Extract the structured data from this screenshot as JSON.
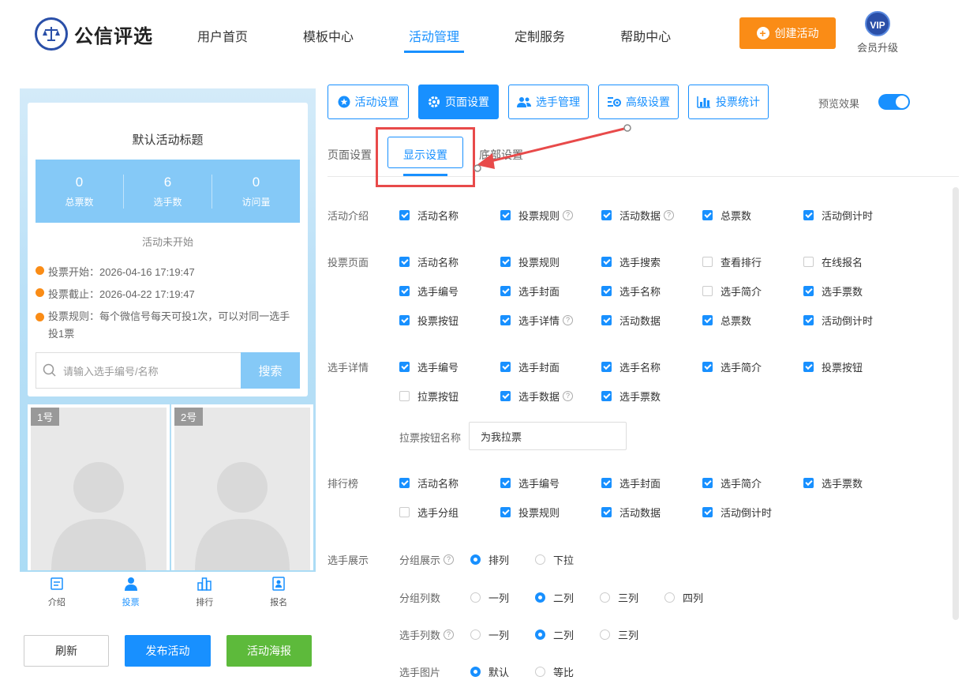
{
  "header": {
    "logo_text": "公信评选",
    "nav": [
      "用户首页",
      "模板中心",
      "活动管理",
      "定制服务",
      "帮助中心"
    ],
    "create_label": "创建活动",
    "vip_badge": "VIP",
    "vip_label": "会员升级"
  },
  "preview": {
    "title": "默认活动标题",
    "stats": [
      {
        "value": "0",
        "label": "总票数"
      },
      {
        "value": "6",
        "label": "选手数"
      },
      {
        "value": "0",
        "label": "访问量"
      }
    ],
    "status": "活动未开始",
    "vote_start": "投票开始：2026-04-16 17:19:47",
    "vote_end": "投票截止：2026-04-22 17:19:47",
    "vote_rule": "投票规则：每个微信号每天可投1次，可以对同一选手投1票",
    "search_placeholder": "请输入选手编号/名称",
    "search_btn": "搜索",
    "players": [
      "1号",
      "2号"
    ],
    "tabs": [
      "介绍",
      "投票",
      "排行",
      "报名"
    ]
  },
  "actions": {
    "refresh": "刷新",
    "publish": "发布活动",
    "poster": "活动海报"
  },
  "toolbar": {
    "buttons": [
      "活动设置",
      "页面设置",
      "选手管理",
      "高级设置",
      "投票统计"
    ],
    "preview_label": "预览效果"
  },
  "subtabs": [
    "页面设置",
    "显示设置",
    "底部设置"
  ],
  "sections": {
    "intro": {
      "label": "活动介绍",
      "options": [
        {
          "text": "活动名称",
          "checked": true
        },
        {
          "text": "投票规则",
          "checked": true,
          "help": "?"
        },
        {
          "text": "活动数据",
          "checked": true,
          "help": "?"
        },
        {
          "text": "总票数",
          "checked": true
        },
        {
          "text": "活动倒计时",
          "checked": true
        }
      ]
    },
    "vote": {
      "label": "投票页面",
      "options": [
        {
          "text": "活动名称",
          "checked": true
        },
        {
          "text": "投票规则",
          "checked": true
        },
        {
          "text": "选手搜索",
          "checked": true
        },
        {
          "text": "查看排行",
          "checked": false
        },
        {
          "text": "在线报名",
          "checked": false
        },
        {
          "text": "选手编号",
          "checked": true
        },
        {
          "text": "选手封面",
          "checked": true
        },
        {
          "text": "选手名称",
          "checked": true
        },
        {
          "text": "选手简介",
          "checked": false
        },
        {
          "text": "选手票数",
          "checked": true
        },
        {
          "text": "投票按钮",
          "checked": true
        },
        {
          "text": "选手详情",
          "checked": true,
          "help": "?"
        },
        {
          "text": "活动数据",
          "checked": true
        },
        {
          "text": "总票数",
          "checked": true
        },
        {
          "text": "活动倒计时",
          "checked": true
        }
      ]
    },
    "detail": {
      "label": "选手详情",
      "options": [
        {
          "text": "选手编号",
          "checked": true
        },
        {
          "text": "选手封面",
          "checked": true
        },
        {
          "text": "选手名称",
          "checked": true
        },
        {
          "text": "选手简介",
          "checked": true
        },
        {
          "text": "投票按钮",
          "checked": true
        },
        {
          "text": "拉票按钮",
          "checked": false
        },
        {
          "text": "选手数据",
          "checked": true,
          "help": "?"
        },
        {
          "text": "选手票数",
          "checked": true
        }
      ],
      "canvass_label": "拉票按钮名称",
      "canvass_value": "为我拉票"
    },
    "rank": {
      "label": "排行榜",
      "options": [
        {
          "text": "活动名称",
          "checked": true
        },
        {
          "text": "选手编号",
          "checked": true
        },
        {
          "text": "选手封面",
          "checked": true
        },
        {
          "text": "选手简介",
          "checked": true
        },
        {
          "text": "选手票数",
          "checked": true
        },
        {
          "text": "选手分组",
          "checked": false
        },
        {
          "text": "投票规则",
          "checked": true
        },
        {
          "text": "活动数据",
          "checked": true
        },
        {
          "text": "活动倒计时",
          "checked": true
        }
      ]
    },
    "display": {
      "label": "选手展示",
      "group_show": {
        "label": "分组展示",
        "help": "?",
        "options": [
          {
            "text": "排列",
            "checked": true
          },
          {
            "text": "下拉",
            "checked": false
          }
        ]
      },
      "group_cols": {
        "label": "分组列数",
        "options": [
          {
            "text": "一列",
            "checked": false
          },
          {
            "text": "二列",
            "checked": true
          },
          {
            "text": "三列",
            "checked": false
          },
          {
            "text": "四列",
            "checked": false
          }
        ]
      },
      "player_cols": {
        "label": "选手列数",
        "help": "?",
        "options": [
          {
            "text": "一列",
            "checked": false
          },
          {
            "text": "二列",
            "checked": true
          },
          {
            "text": "三列",
            "checked": false
          }
        ]
      },
      "player_img": {
        "label": "选手图片",
        "options": [
          {
            "text": "默认",
            "checked": true
          },
          {
            "text": "等比",
            "checked": false
          }
        ]
      }
    }
  }
}
